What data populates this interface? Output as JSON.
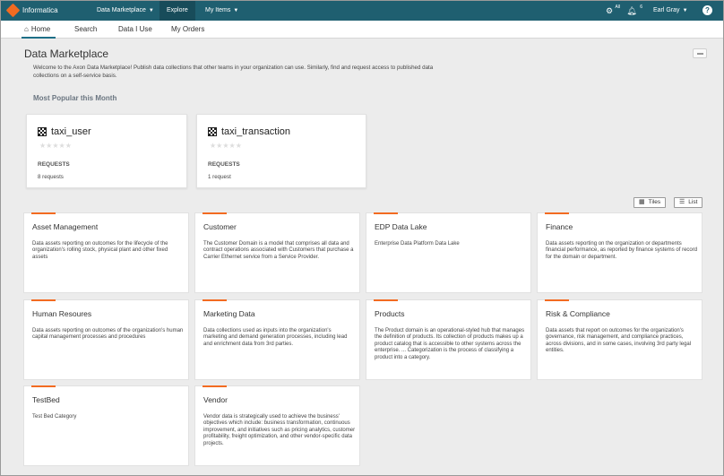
{
  "app": {
    "brand": "Informatica",
    "nav": [
      {
        "label": "Data Marketplace",
        "has_caret": true
      },
      {
        "label": "Explore",
        "has_caret": false
      },
      {
        "label": "My Items",
        "has_caret": true
      }
    ],
    "notifications_badge": "All",
    "alerts_badge": "6",
    "user": "Earl Gray",
    "help": "?"
  },
  "tabs": [
    {
      "label": "Home"
    },
    {
      "label": "Search"
    },
    {
      "label": "Data I Use"
    },
    {
      "label": "My Orders"
    }
  ],
  "page": {
    "title": "Data Marketplace",
    "intro": "Welcome to the Axon Data Marketplace! Publish data collections that other teams in your organization can use. Similarly, find and request access to published data collections on a self-service basis.",
    "popular_title": "Most Popular this Month"
  },
  "popular": [
    {
      "title": "taxi_user",
      "stars": "★★★★★",
      "requests_label": "REQUESTS",
      "requests": "8 requests"
    },
    {
      "title": "taxi_transaction",
      "stars": "★★★★★",
      "requests_label": "REQUESTS",
      "requests": "1 request"
    }
  ],
  "view_toggle": {
    "tiles": "Tiles",
    "list": "List"
  },
  "domains": [
    {
      "title": "Asset Management",
      "desc": "Data assets reporting on outcomes for the lifecycle of the organization's rolling stock, physical plant and other fixed assets"
    },
    {
      "title": "Customer",
      "desc": "The Customer Domain is a model that comprises all data and contract operations associated with Customers that purchase a Carrier Ethernet service from a Service Provider."
    },
    {
      "title": "EDP Data Lake",
      "desc": "Enterprise Data Platform Data Lake"
    },
    {
      "title": "Finance",
      "desc": "Data assets reporting on the organization or departments financial performance, as reported by finance systems of record for the domain or department."
    },
    {
      "title": "Human Resoures",
      "desc": "Data assets reporting on outcomes of the organization's human capital management processes and procedures"
    },
    {
      "title": "Marketing Data",
      "desc": "Data collections used as inputs into the organization's marketing and demand generation processes, including lead and enrichment data from 3rd parties."
    },
    {
      "title": "Products",
      "desc": "The Product domain is an operational-styled hub that manages the definition of products. Its collection of products makes up a product catalog that is accessible to other systems across the enterprise. ... Categorization is the process of classifying a product into a category."
    },
    {
      "title": "Risk & Compliance",
      "desc": "Data assets that report on outcomes for the organization's governance, risk management, and compliance practices, across divisions, and in some cases, involving 3rd party legal entities."
    },
    {
      "title": "TestBed",
      "desc": "Test Bed Category"
    },
    {
      "title": "Vendor",
      "desc": "Vendor data is strategically used to achieve the business' objectives which include: business transformation, continuous improvement, and initiatives such as pricing analytics, customer profitability, freight optimization, and other vendor-specific data projects."
    }
  ],
  "colors": {
    "topbar": "#1f5f70",
    "accent": "#f26b21",
    "tab_active": "#1d6f87"
  }
}
